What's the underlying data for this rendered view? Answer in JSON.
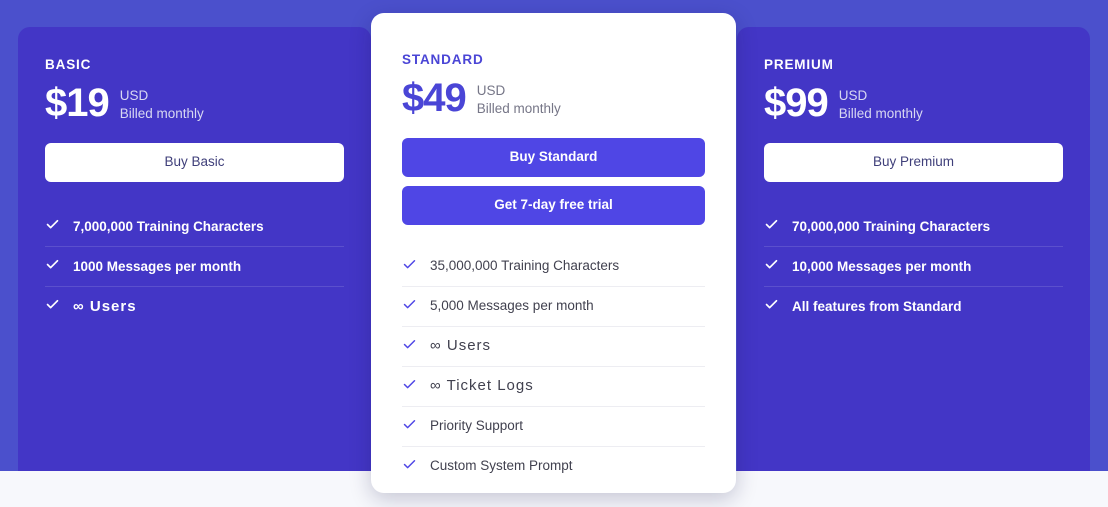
{
  "theme": {
    "page_background": "#f7f8fc",
    "stage_background": "#4b50cc",
    "side_card_background": "#4336c6",
    "accent": "#4f46e5",
    "accent_text": "#4a45d6",
    "white": "#ffffff"
  },
  "plans": [
    {
      "id": "basic",
      "name": "BASIC",
      "price": "$19",
      "currency": "USD",
      "billing": "Billed monthly",
      "buttons": [
        {
          "label": "Buy Basic",
          "style": "light"
        }
      ],
      "features": [
        "7,000,000 Training Characters",
        "1000 Messages per month",
        "∞ Users"
      ]
    },
    {
      "id": "standard",
      "name": "STANDARD",
      "price": "$49",
      "currency": "USD",
      "billing": "Billed monthly",
      "buttons": [
        {
          "label": "Buy Standard",
          "style": "solid"
        },
        {
          "label": "Get 7-day free trial",
          "style": "solid"
        }
      ],
      "features": [
        "35,000,000 Training Characters",
        "5,000 Messages per month",
        "∞ Users",
        "∞ Ticket Logs",
        "Priority Support",
        "Custom System Prompt"
      ]
    },
    {
      "id": "premium",
      "name": "PREMIUM",
      "price": "$99",
      "currency": "USD",
      "billing": "Billed monthly",
      "buttons": [
        {
          "label": "Buy Premium",
          "style": "light"
        }
      ],
      "features": [
        "70,000,000 Training Characters",
        "10,000 Messages per month",
        "All features from Standard"
      ]
    }
  ],
  "icons": {
    "check": "check-icon"
  }
}
